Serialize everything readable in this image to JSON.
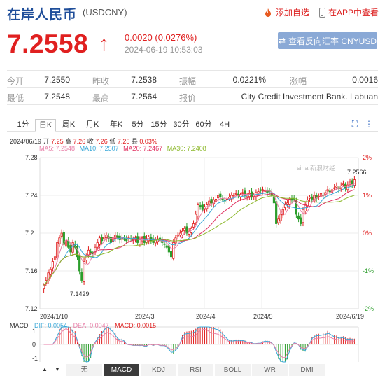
{
  "header": {
    "title": "在岸人民币",
    "code": "(USDCNY)",
    "favorite_label": "添加自选",
    "app_label": "在APP中查看"
  },
  "quote": {
    "price": "7.2558",
    "arrow": "↑",
    "change": "0.0020 (0.0276%)",
    "time": "2024-06-19 10:53:03",
    "reverse_button": "查看反向汇率 CNYUSD"
  },
  "stats": {
    "row1": [
      {
        "label": "今开",
        "value": "7.2550"
      },
      {
        "label": "昨收",
        "value": "7.2538"
      },
      {
        "label": "振幅",
        "value": "0.0221%"
      },
      {
        "label": "涨幅",
        "value": "0.0016"
      }
    ],
    "row2": [
      {
        "label": "最低",
        "value": "7.2548"
      },
      {
        "label": "最高",
        "value": "7.2564"
      },
      {
        "label": "报价",
        "value": "City Credit Investment Bank. Labuan"
      }
    ]
  },
  "period_tabs": [
    "1分",
    "日K",
    "周K",
    "月K",
    "年K",
    "5分",
    "15分",
    "30分",
    "60分",
    "4H"
  ],
  "active_period": "日K",
  "ohlc": {
    "date": "2024/06/19",
    "open_label": "开",
    "open": "7.25",
    "high_label": "高",
    "high": "7.26",
    "close_label": "收",
    "close": "7.26",
    "low_label": "低",
    "low": "7.25",
    "amp_label": "县",
    "amp": "0.03%"
  },
  "ma_legend": [
    {
      "label": "MA5: 7.2548",
      "color": "#e87fa8"
    },
    {
      "label": "MA10: 7.2507",
      "color": "#3aa8d8"
    },
    {
      "label": "MA20: 7.2467",
      "color": "#e03060"
    },
    {
      "label": "MA30: 7.2408",
      "color": "#8cb82a"
    }
  ],
  "watermark": "sina 新浪财经",
  "chart_data": {
    "type": "candlestick",
    "y_ticks": [
      "7.28",
      "7.24",
      "7.2",
      "7.16",
      "7.12"
    ],
    "pct_ticks": [
      "2%",
      "1%",
      "0%",
      "-1%",
      "-2%"
    ],
    "ylim": [
      7.12,
      7.28
    ],
    "x_ticks": [
      "2024/1/10",
      "2024/3",
      "2024/4",
      "2024/5",
      "2024/6/19"
    ],
    "annotations": [
      {
        "label": "7.2566"
      },
      {
        "label": "7.1429"
      }
    ],
    "closes": [
      7.145,
      7.15,
      7.158,
      7.162,
      7.17,
      7.175,
      7.19,
      7.195,
      7.2,
      7.188,
      7.192,
      7.185,
      7.18,
      7.19,
      7.185,
      7.175,
      7.16,
      7.15,
      7.17,
      7.176,
      7.182,
      7.18,
      7.178,
      7.185,
      7.19,
      7.195,
      7.192,
      7.196,
      7.198,
      7.194,
      7.19,
      7.196,
      7.198,
      7.195,
      7.193,
      7.196,
      7.194,
      7.192,
      7.195,
      7.194,
      7.193,
      7.195,
      7.19,
      7.193,
      7.195,
      7.19,
      7.194,
      7.196,
      7.192,
      7.19,
      7.193,
      7.194,
      7.192,
      7.19,
      7.188,
      7.185,
      7.18,
      7.175,
      7.19,
      7.195,
      7.198,
      7.2,
      7.202,
      7.205,
      7.2,
      7.202,
      7.205,
      7.21,
      7.22,
      7.23,
      7.228,
      7.225,
      7.228,
      7.23,
      7.234,
      7.232,
      7.235,
      7.236,
      7.24,
      7.238,
      7.236,
      7.234,
      7.236,
      7.238,
      7.24,
      7.24,
      7.242,
      7.24,
      7.241,
      7.243,
      7.24,
      7.24,
      7.242,
      7.238,
      7.24,
      7.243,
      7.244,
      7.245,
      7.246,
      7.245,
      7.243,
      7.244,
      7.24,
      7.232,
      7.21,
      7.215,
      7.22,
      7.225,
      7.23,
      7.232,
      7.236,
      7.235,
      7.236,
      7.22,
      7.215,
      7.21,
      7.225,
      7.23,
      7.235,
      7.238,
      7.236,
      7.24,
      7.237,
      7.239,
      7.242,
      7.24,
      7.243,
      7.246,
      7.244,
      7.246,
      7.248,
      7.25,
      7.247,
      7.25,
      7.252,
      7.248,
      7.251,
      7.254,
      7.252,
      7.2566
    ],
    "ma": [
      {
        "name": "MA5",
        "color": "#e87fa8"
      },
      {
        "name": "MA10",
        "color": "#3aa8d8"
      },
      {
        "name": "MA20",
        "color": "#e03060"
      },
      {
        "name": "MA30",
        "color": "#8cb82a"
      }
    ]
  },
  "macd_legend": [
    {
      "label": "MACD",
      "color": "#333"
    },
    {
      "label": "DIF: 0.0054",
      "color": "#3aa8d8"
    },
    {
      "label": "DEA: 0.0047",
      "color": "#e87fa8"
    },
    {
      "label": "MACD: 0.0015",
      "color": "#e02020"
    }
  ],
  "macd_ticks": [
    "1",
    "0",
    "-1"
  ],
  "bottom_tabs": [
    "无",
    "MACD",
    "KDJ",
    "RSI",
    "BOLL",
    "WR",
    "DMI"
  ],
  "active_bottom_tab": "MACD",
  "nav": {
    "up": "▲",
    "down": "▼"
  }
}
